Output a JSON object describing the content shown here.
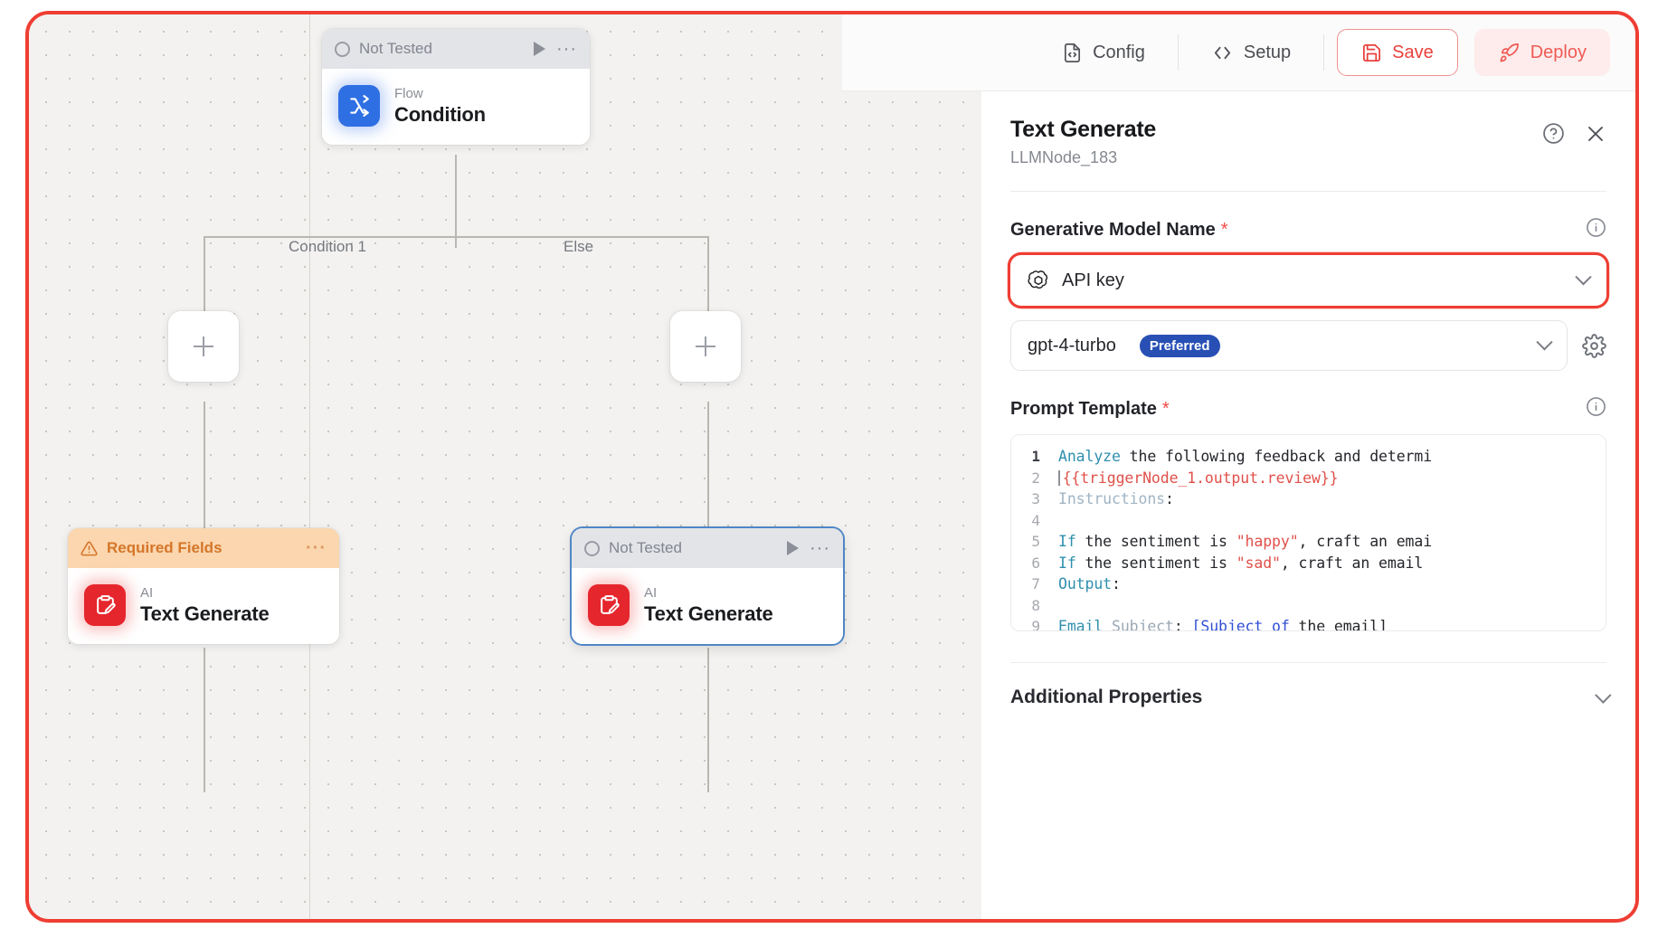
{
  "toolbar": {
    "config_label": "Config",
    "setup_label": "Setup",
    "save_label": "Save",
    "deploy_label": "Deploy",
    "config_icon": "file-code-icon",
    "setup_icon": "code-brackets-icon",
    "save_icon": "floppy-disk-icon",
    "deploy_icon": "rocket-icon",
    "accent_red": "#ef3e33",
    "deploy_bg": "#fdeceb"
  },
  "canvas": {
    "nodes": [
      {
        "id": "condition",
        "status": "Not Tested",
        "status_type": "not-tested",
        "category": "Flow",
        "title": "Condition",
        "icon": "branch-split-icon",
        "icon_color": "#2f6fe4",
        "selected": false,
        "has_play": true
      },
      {
        "id": "text-generate-left",
        "status": "Required Fields",
        "status_type": "required-fields",
        "category": "AI",
        "title": "Text Generate",
        "icon": "clipboard-pencil-icon",
        "icon_color": "#e5262c",
        "selected": false,
        "has_play": false
      },
      {
        "id": "text-generate-right",
        "status": "Not Tested",
        "status_type": "not-tested",
        "category": "AI",
        "title": "Text Generate",
        "icon": "clipboard-pencil-icon",
        "icon_color": "#e5262c",
        "selected": true,
        "has_play": true
      }
    ],
    "branch_labels": [
      "Condition 1",
      "Else"
    ],
    "add_button_icon": "plus-icon"
  },
  "panel": {
    "title": "Text Generate",
    "subtitle": "LLMNode_183",
    "help_icon": "question-circle-icon",
    "close_icon": "close-icon",
    "model_field": {
      "label": "Generative Model Name",
      "required_marker": "*",
      "info_icon": "info-circle-icon",
      "credential_value": "API key",
      "credential_icon": "openai-icon",
      "model_value": "gpt-4-turbo",
      "model_badge": "Preferred",
      "settings_icon": "gear-icon",
      "chevron_icon": "chevron-down-icon"
    },
    "prompt_field": {
      "label": "Prompt Template",
      "required_marker": "*",
      "info_icon": "info-circle-icon",
      "lines": [
        {
          "n": "1",
          "current": true,
          "tokens": [
            {
              "t": "Analyze",
              "c": "t-kw"
            },
            {
              "t": " the following feedback and determi",
              "c": ""
            }
          ]
        },
        {
          "n": "2",
          "current": false,
          "cursor": true,
          "tokens": [
            {
              "t": "{{triggerNode_1.output.review}}",
              "c": "t-var"
            }
          ]
        },
        {
          "n": "3",
          "current": false,
          "tokens": [
            {
              "t": "Instructions",
              "c": "t-dim"
            },
            {
              "t": ":",
              "c": ""
            }
          ]
        },
        {
          "n": "4",
          "current": false,
          "tokens": [
            {
              "t": "",
              "c": ""
            }
          ]
        },
        {
          "n": "5",
          "current": false,
          "tokens": [
            {
              "t": "If",
              "c": "t-kw"
            },
            {
              "t": " the sentiment is ",
              "c": ""
            },
            {
              "t": "\"happy\"",
              "c": "t-str"
            },
            {
              "t": ", craft an emai",
              "c": ""
            }
          ]
        },
        {
          "n": "6",
          "current": false,
          "tokens": [
            {
              "t": "If",
              "c": "t-kw"
            },
            {
              "t": " the sentiment is ",
              "c": ""
            },
            {
              "t": "\"sad\"",
              "c": "t-str"
            },
            {
              "t": ", craft an email",
              "c": ""
            }
          ]
        },
        {
          "n": "7",
          "current": false,
          "tokens": [
            {
              "t": "Output",
              "c": "t-kw"
            },
            {
              "t": ":",
              "c": ""
            }
          ]
        },
        {
          "n": "8",
          "current": false,
          "tokens": [
            {
              "t": "",
              "c": ""
            }
          ]
        },
        {
          "n": "9",
          "current": false,
          "tokens": [
            {
              "t": "Email",
              "c": "t-kw"
            },
            {
              "t": " ",
              "c": ""
            },
            {
              "t": "Subject",
              "c": "t-lite"
            },
            {
              "t": ": ",
              "c": ""
            },
            {
              "t": "[Subject",
              "c": "t-blue"
            },
            {
              "t": " ",
              "c": ""
            },
            {
              "t": "of",
              "c": "t-blue"
            },
            {
              "t": " the email]",
              "c": ""
            }
          ]
        }
      ]
    },
    "additional_properties": {
      "label": "Additional Properties",
      "chevron_icon": "chevron-down-icon"
    }
  }
}
